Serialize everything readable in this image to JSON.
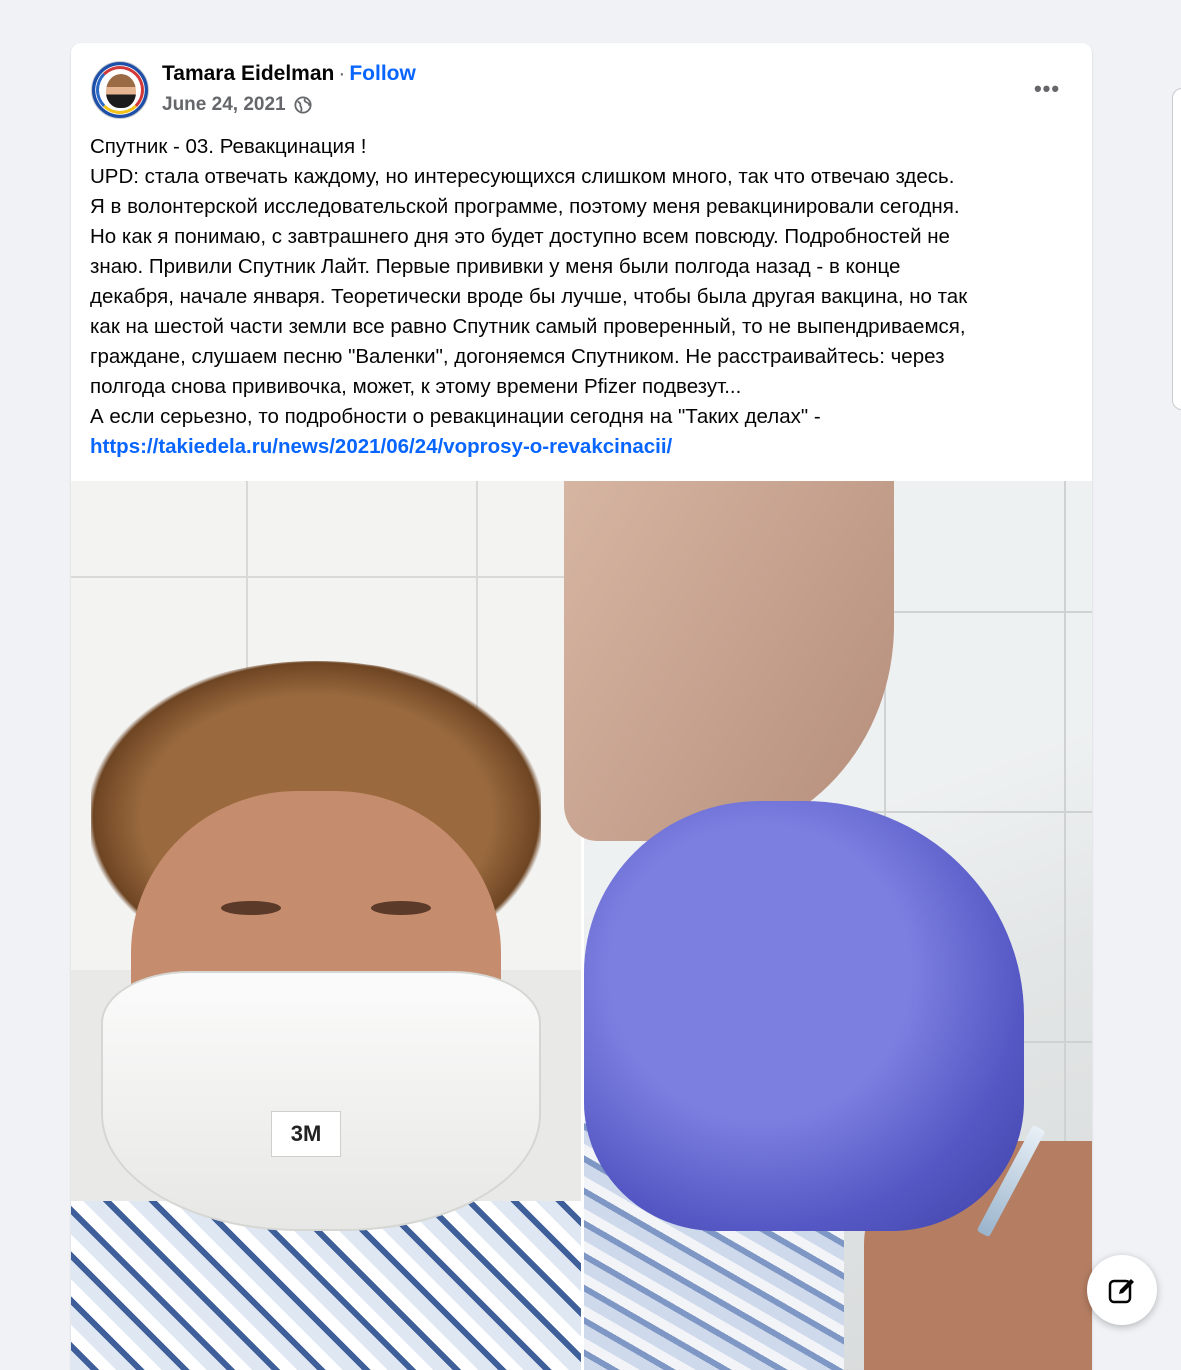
{
  "post": {
    "author": "Tamara Eidelman",
    "separator": "·",
    "follow_label": "Follow",
    "date": "June 24, 2021",
    "audience_icon": "globe-icon",
    "more_label": "•••",
    "text_lines": [
      "Спутник - 03. Ревакцинация !",
      "UPD: стала отвечать каждому, но интересующихся слишком много, так что отвечаю здесь.",
      "Я в волонтерской исследовательской программе, поэтому меня ревакцинировали сегодня.",
      "Но как я понимаю, с завтрашнего дня это будет доступно всем повсюду. Подробностей не",
      "знаю. Привили Спутник Лайт. Первые прививки у меня были полгода назад - в конце",
      "декабря, начале января. Теоретически вроде бы лучше, чтобы была другая вакцина, но так",
      "как на шестой части земли все равно Спутник самый проверенный, то не выпендриваемся,",
      "граждане, слушаем песню \"Валенки\", догоняемся Спутником. Не расстраивайтесь: через",
      "полгода снова прививочка, может, к этому времени Pfizer подвезут...",
      "А если серьезно, то подробности о ревакцинации сегодня на \"Таких делах\" -"
    ],
    "link": "https://takiedela.ru/news/2021/06/24/voprosy-o-revakcinacii/",
    "photos": [
      {
        "name": "selfie-with-respirator",
        "mask_text": "3M"
      },
      {
        "name": "vaccine-injection"
      }
    ]
  },
  "compose_icon": "edit-icon",
  "colors": {
    "accent": "#0866ff",
    "secondary_text": "#65676b",
    "background": "#f0f2f5"
  }
}
